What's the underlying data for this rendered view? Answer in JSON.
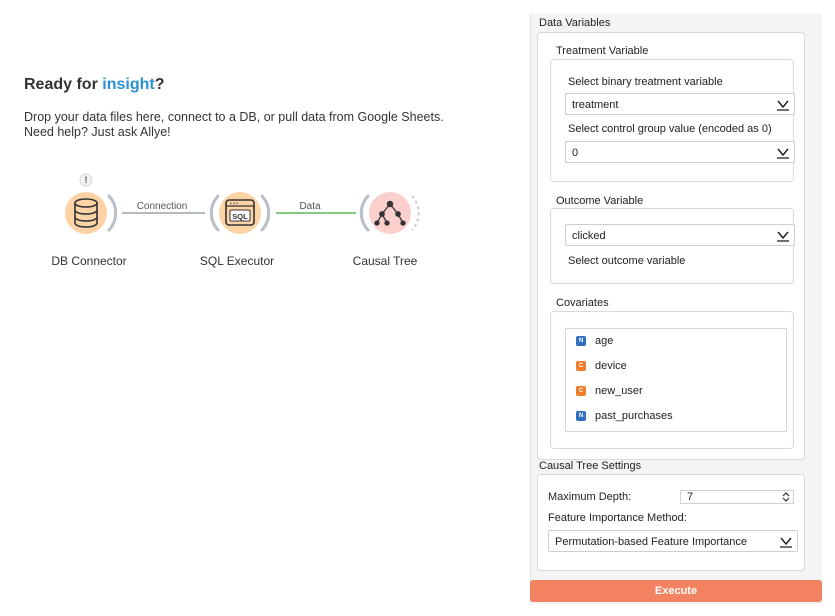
{
  "canvas": {
    "headline_prefix": "Ready for ",
    "headline_accent": "insight",
    "headline_suffix": "?",
    "intro_line1": "Drop your data files here, connect to a DB, or pull data from Google Sheets.",
    "intro_line2": "Need help? Just ask Allye!",
    "nodes": [
      {
        "label": "DB Connector",
        "icon": "database-icon",
        "warning": "!"
      },
      {
        "label": "SQL Executor",
        "icon": "sql-icon",
        "icon_text": "SQL"
      },
      {
        "label": "Causal Tree",
        "icon": "tree-network-icon"
      }
    ],
    "links": [
      {
        "label": "Connection"
      },
      {
        "label": "Data"
      }
    ]
  },
  "panel": {
    "data_variables": {
      "title": "Data Variables",
      "treatment": {
        "title": "Treatment Variable",
        "select_label": "Select binary treatment variable",
        "select_value": "treatment",
        "control_label": "Select control group value (encoded as 0)",
        "control_value": "0"
      },
      "outcome": {
        "title": "Outcome Variable",
        "select_value": "clicked",
        "select_label": "Select outcome variable"
      },
      "covariates": {
        "title": "Covariates",
        "items": [
          {
            "badge": "N",
            "name": "age"
          },
          {
            "badge": "C",
            "name": "device"
          },
          {
            "badge": "C",
            "name": "new_user"
          },
          {
            "badge": "N",
            "name": "past_purchases"
          }
        ]
      }
    },
    "settings": {
      "title": "Causal Tree Settings",
      "max_depth_label": "Maximum Depth:",
      "max_depth_value": "7",
      "importance_label": "Feature Importance Method:",
      "importance_value": "Permutation-based Feature Importance"
    },
    "execute_label": "Execute"
  },
  "colors": {
    "accent": "#2a8fd6",
    "node_fill": "#fbd3a5",
    "causal_fill": "#fbd0cc",
    "execute": "#f28260",
    "numeric_badge": "#2f6fbf",
    "categorical_badge": "#ef7d2b",
    "data_link": "#5cb85c"
  }
}
